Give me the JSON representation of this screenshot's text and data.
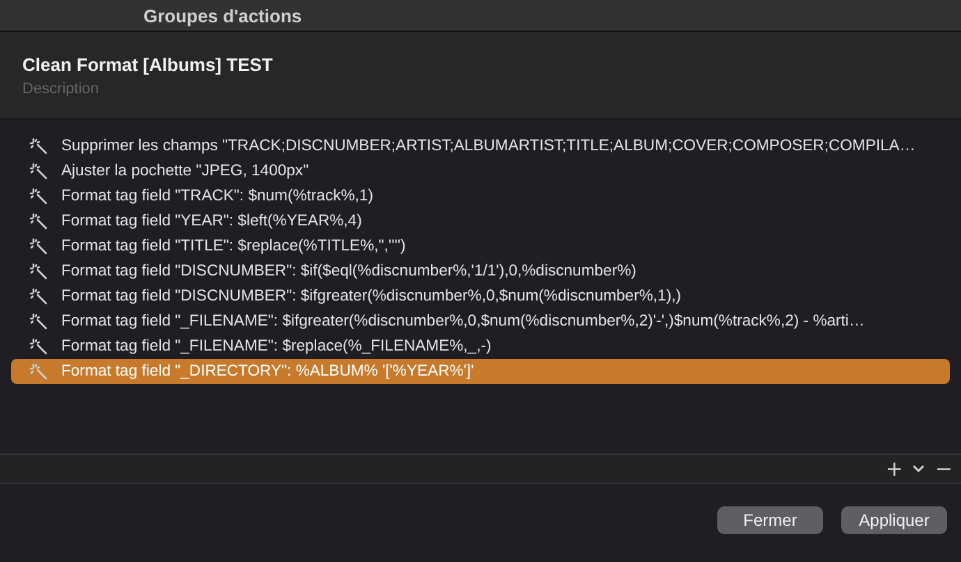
{
  "window": {
    "title": "Groupes d'actions"
  },
  "group": {
    "name": "Clean Format [Albums] TEST",
    "description_placeholder": "Description"
  },
  "actions": [
    {
      "label": "Supprimer les champs \"TRACK;DISCNUMBER;ARTIST;ALBUMARTIST;TITLE;ALBUM;COVER;COMPOSER;COMPILA…",
      "selected": false
    },
    {
      "label": "Ajuster la pochette \"JPEG, 1400px\"",
      "selected": false
    },
    {
      "label": "Format tag field \"TRACK\": $num(%track%,1)",
      "selected": false
    },
    {
      "label": "Format tag field \"YEAR\": $left(%YEAR%,4)",
      "selected": false
    },
    {
      "label": "Format tag field \"TITLE\": $replace(%TITLE%,\",'''')",
      "selected": false
    },
    {
      "label": "Format tag field \"DISCNUMBER\": $if($eql(%discnumber%,'1/1'),0,%discnumber%)",
      "selected": false
    },
    {
      "label": "Format tag field \"DISCNUMBER\": $ifgreater(%discnumber%,0,$num(%discnumber%,1),)",
      "selected": false
    },
    {
      "label": "Format tag field \"_FILENAME\": $ifgreater(%discnumber%,0,$num(%discnumber%,2)'-',)$num(%track%,2) - %arti…",
      "selected": false
    },
    {
      "label": "Format tag field \"_FILENAME\": $replace(%_FILENAME%,_,-)",
      "selected": false
    },
    {
      "label": "Format tag field \"_DIRECTORY\": %ALBUM% '['%YEAR%']'",
      "selected": true
    }
  ],
  "list_toolbar": {
    "add": "+",
    "remove": "−"
  },
  "buttons": [
    "Fermer",
    "Appliquer"
  ]
}
